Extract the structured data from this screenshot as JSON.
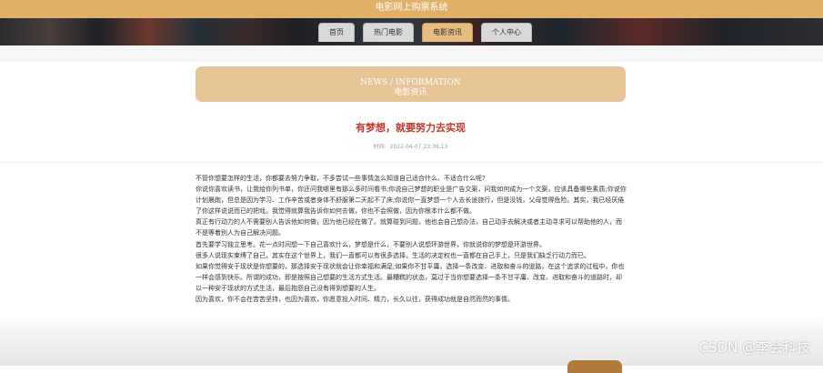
{
  "app": {
    "title": "电影网上购票系统"
  },
  "nav": {
    "items": [
      {
        "label": "首页"
      },
      {
        "label": "热门电影"
      },
      {
        "label": "电影资讯"
      },
      {
        "label": "个人中心"
      }
    ],
    "active_index": 2,
    "active_color": "#e7bd80"
  },
  "news_header": {
    "en": "NEWS / INFORMATION",
    "zh": "电影资讯",
    "color": "#e7c597"
  },
  "article": {
    "title": "有梦想，就要努力去实现",
    "title_color": "#c0392b",
    "time_label": "时间:",
    "time": "2022-04-07 23:36:13",
    "paragraphs": [
      "不管你想要怎样的生活，你都要去努力争取，不多尝试一些事情怎么知道自己适合什么、不适合什么呢?",
      "你说你喜欢读书，让我给你列书单，你还问我哪里有那么多时间看书;你说自己梦想的职业是广告文案，问我如何成为一个文案，应该具备哪些素质;你说你计划晨跑，但总是因为学习、工作辛苦或者身体不舒服第二天起不了床;你说你一直梦想一个人去长途旅行，但是没钱，父母觉得危险。其实，我已经厌倦了你这样说说而已的把戏，我觉得就算我告诉你如何去做，你也不会照做，因为你根本什么都不做。",
      "真正有行动力的人不需要别人告诉他如何做，因为他已经在做了。就算碰到问题，他也会自己想办法，自己动手去解决或者主动寻求可以帮助他的人，而不是等着别人为自己解决问题。",
      "首先要学习独立思考。花一点时间想一下自己喜欢什么，梦想是什么，不要别人说想环游世界，你就说你的梦想是环游世界。",
      "很多人说现实束缚了自己，其实在这个世界上，我们一直都可以有很多选择，生活的决定权也一直都在自己手上，只是我们缺乏行动力而已。",
      "如果你觉得安于现状是你想要的，那选择安于现状就会让你幸福和满足;如果你不甘平庸，选择一条改变、进取和奋斗的道路，在这个追求的过程中，你也一样会感到快乐。所谓的成功，即是按照自己想要的生活方式生活。最糟糕的状态，莫过于当你想要选择一条不甘平庸、改变、进取和奋斗的道路时，却以一种安于现状的方式生活，最后抱怨自己没有得到想要的人生。",
      "因为喜欢，你不会在苦苦坚持，也因为喜欢，你愿意投入时间、精力，长久以往，获得成功就是自然而然的事情。"
    ]
  },
  "watermark": "CSDN @李会科技",
  "colors": {
    "topbar": "#e0b068",
    "accent": "#b07a3a"
  }
}
